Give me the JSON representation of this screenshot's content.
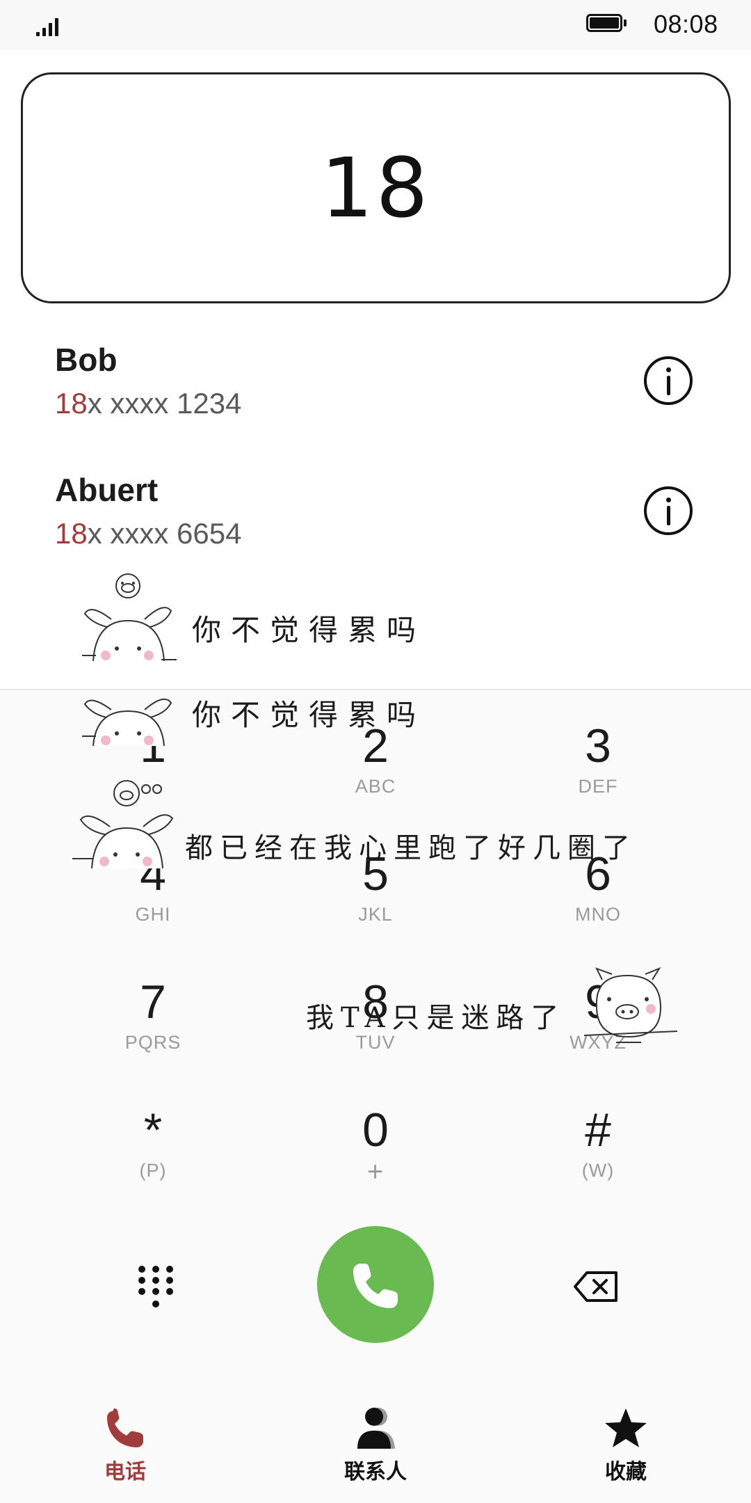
{
  "status_bar": {
    "time": "08:08",
    "signal_icon": "signal-bars-icon",
    "battery_icon": "battery-full-icon"
  },
  "dial_display": {
    "digits": "18"
  },
  "suggestions": [
    {
      "name": "Bob",
      "number_match": "18",
      "number_rest": "x xxxx 1234",
      "info_icon": "info-icon"
    },
    {
      "name": "Abuert",
      "number_match": "18",
      "number_rest": "x xxxx 6654",
      "info_icon": "info-icon"
    }
  ],
  "stickers": [
    {
      "text": "你不觉得累吗"
    },
    {
      "text": "你不觉得累吗"
    },
    {
      "text": "都已经在我心里跑了好几圈了"
    },
    {
      "text": "我TA只是迷路了"
    }
  ],
  "keypad": [
    {
      "digit": "1",
      "letters": ""
    },
    {
      "digit": "2",
      "letters": "ABC"
    },
    {
      "digit": "3",
      "letters": "DEF"
    },
    {
      "digit": "4",
      "letters": "GHI"
    },
    {
      "digit": "5",
      "letters": "JKL"
    },
    {
      "digit": "6",
      "letters": "MNO"
    },
    {
      "digit": "7",
      "letters": "PQRS"
    },
    {
      "digit": "8",
      "letters": "TUV"
    },
    {
      "digit": "9",
      "letters": "WXYZ"
    },
    {
      "digit": "*",
      "letters": "(P)"
    },
    {
      "digit": "0",
      "letters": "+"
    },
    {
      "digit": "#",
      "letters": "(W)"
    }
  ],
  "actions": {
    "dialpad_icon": "dialpad-grid-icon",
    "call_icon": "phone-icon",
    "backspace_icon": "backspace-icon",
    "call_color": "#6aba52"
  },
  "bottom_nav": {
    "items": [
      {
        "label": "电话",
        "icon": "phone-icon",
        "active": true
      },
      {
        "label": "联系人",
        "icon": "person-icon",
        "active": false
      },
      {
        "label": "收藏",
        "icon": "star-icon",
        "active": false
      }
    ],
    "active_color": "#a13c3c"
  }
}
